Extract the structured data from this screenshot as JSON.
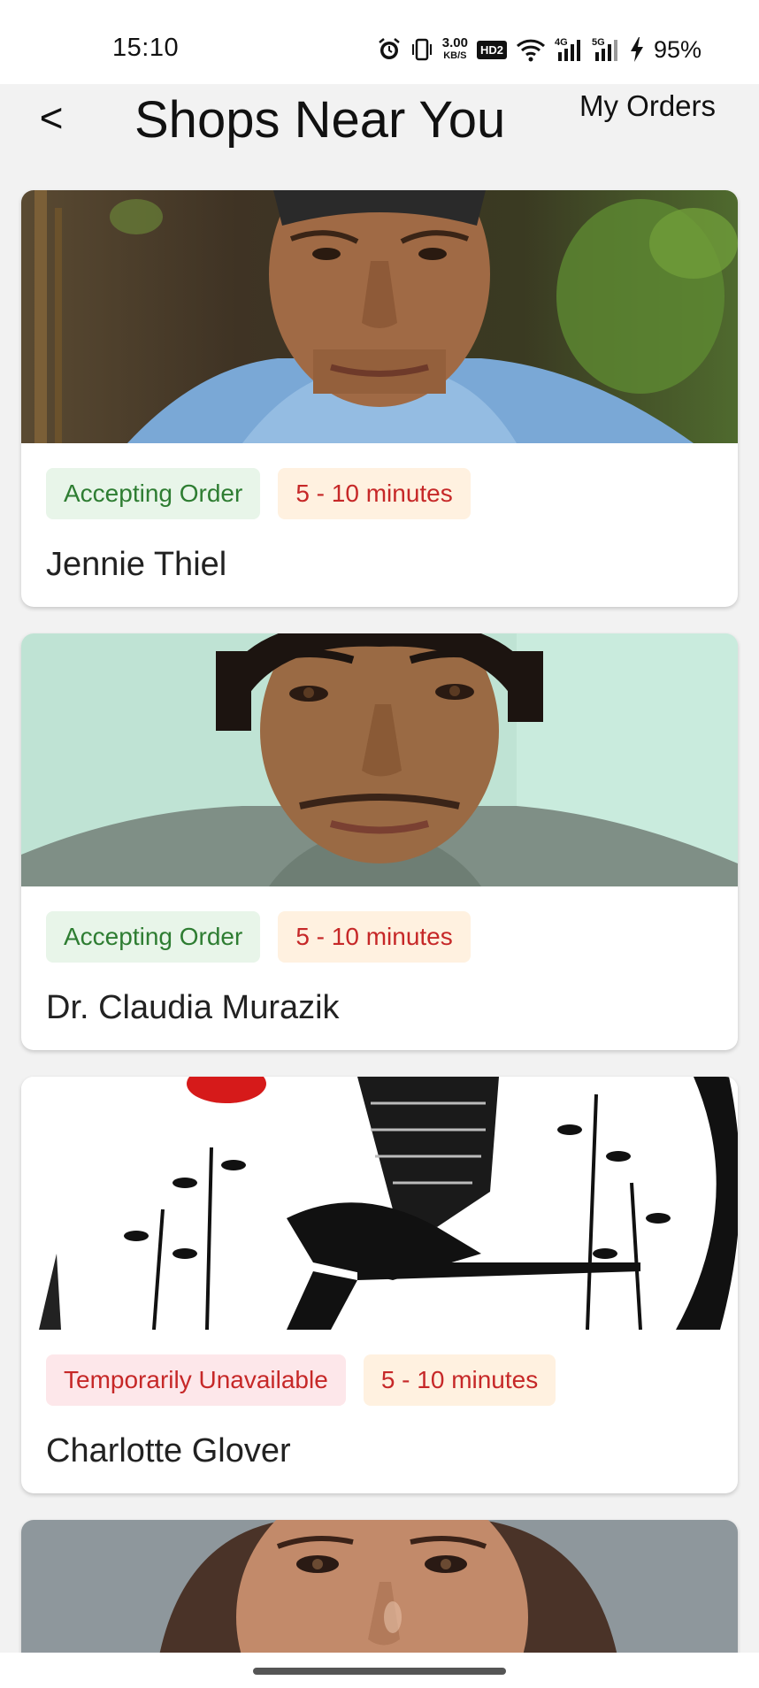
{
  "status_bar": {
    "time": "15:10",
    "net_speed_value": "3.00",
    "net_speed_unit": "KB/S",
    "hd_label": "HD2",
    "sim1_label": "4G",
    "sim2_label": "5G",
    "battery": "95%",
    "icons": [
      "alarm-icon",
      "vibrate-icon",
      "wifi-icon",
      "signal-icon",
      "signal-icon",
      "charging-icon"
    ]
  },
  "header": {
    "back_label": "<",
    "title": "Shops Near You",
    "orders_link": "My Orders"
  },
  "shops": [
    {
      "status": "Accepting Order",
      "eta": "5 - 10 minutes",
      "name": "Jennie Thiel"
    },
    {
      "status": "Accepting Order",
      "eta": "5 - 10 minutes",
      "name": "Dr. Claudia Murazik"
    },
    {
      "status": "Temporarily Unavailable",
      "eta": "5 - 10 minutes",
      "name": "Charlotte Glover"
    }
  ],
  "colors": {
    "accepting_bg": "#e8f5e9",
    "accepting_text": "#2e7d32",
    "unavailable_bg": "#fde7ea",
    "unavailable_text": "#c62828",
    "eta_bg": "#fff1e0",
    "eta_text": "#c62828"
  }
}
